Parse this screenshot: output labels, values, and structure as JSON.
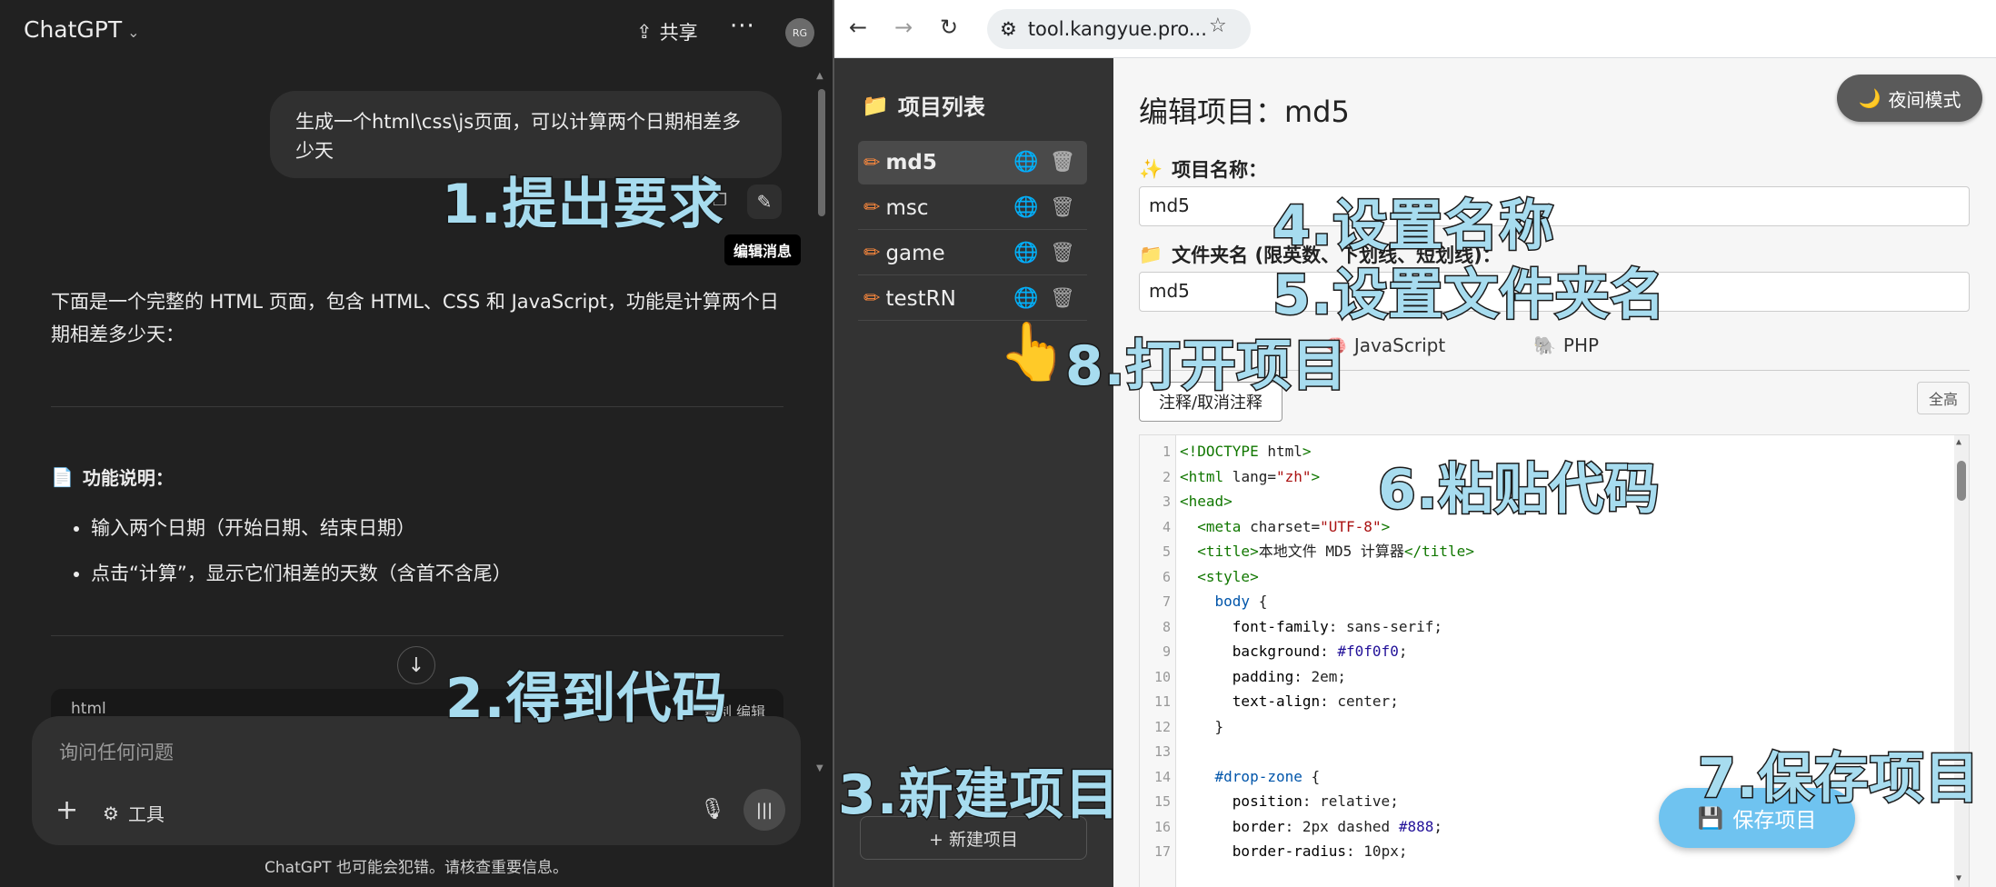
{
  "chat": {
    "brand": "ChatGPT",
    "share_label": "共享",
    "avatar_initials": "RG",
    "user_message": "生成一个html\\css\\js页面，可以计算两个日期相差多少天",
    "edit_tooltip": "编辑消息",
    "answer_intro": "下面是一个完整的 HTML 页面，包含 HTML、CSS 和 JavaScript，功能是计算两个日期相差多少天：",
    "feature_title": "功能说明：",
    "features": [
      "输入两个日期（开始日期、结束日期）",
      "点击“计算”，显示它们相差的天数（含首不含尾）"
    ],
    "code_lang": "html",
    "code_actions": "复制 编辑",
    "composer_placeholder": "询问任何问题",
    "tools_label": "工具",
    "disclaimer": "ChatGPT 也可能会犯错。请核查重要信息。"
  },
  "browser": {
    "url": "tool.kangyue.pro..."
  },
  "sidebar": {
    "title": "项目列表",
    "items": [
      "md5",
      "msc",
      "game",
      "testRN"
    ],
    "active_index": 0,
    "new_project_label": "+ 新建项目"
  },
  "editor": {
    "heading": "编辑项目：md5",
    "night_mode_label": "夜间模式",
    "name_label": "项目名称：",
    "name_value": "md5",
    "folder_label": "文件夹名 (限英数、下划线、短划线)：",
    "folder_value": "md5",
    "tabs": [
      "JavaScript",
      "PHP"
    ],
    "comment_button": "注释/取消注释",
    "fullscreen_button": "全高",
    "save_button": "保存项目",
    "code_lines": [
      "<!DOCTYPE html>",
      "<html lang=\"zh\">",
      "<head>",
      "  <meta charset=\"UTF-8\">",
      "  <title>本地文件 MD5 计算器</title>",
      "  <style>",
      "    body {",
      "      font-family: sans-serif;",
      "      background: #f0f0f0;",
      "      padding: 2em;",
      "      text-align: center;",
      "    }",
      "",
      "    #drop-zone {",
      "      position: relative;",
      "      border: 2px dashed #888;",
      "      border-radius: 10px;"
    ]
  },
  "annotations": {
    "a1": "1.提出要求",
    "a2": "2.得到代码",
    "a3": "3.新建项目",
    "a4": "4.设置名称",
    "a5": "5.设置文件夹名",
    "a6": "6.粘贴代码",
    "a7": "7.保存项目",
    "a8": "8.打开项目"
  }
}
